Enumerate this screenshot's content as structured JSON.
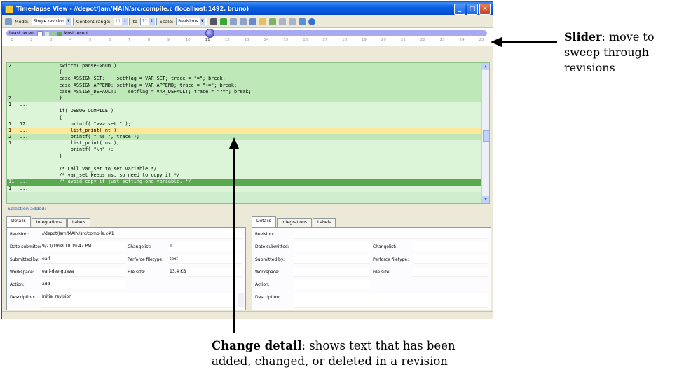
{
  "window": {
    "title": "Time-lapse View - //depot/Jam/MAIN/src/compile.c (localhost:1492, bruno)"
  },
  "toolbar": {
    "mode_label": "Mode:",
    "mode_value": "Single revision",
    "range_label": "Content range:",
    "range_from": "11",
    "range_to_label": "to",
    "range_to": "11",
    "scale_label": "Scale:",
    "scale_value": "Revisions"
  },
  "slider": {
    "least_recent": "Least recent",
    "most_recent": "Most recent",
    "ticks": [
      "1",
      "2",
      "3",
      "4",
      "5",
      "6",
      "7",
      "8",
      "9",
      "10",
      "11",
      "12",
      "13",
      "14",
      "15",
      "16",
      "17",
      "18",
      "19",
      "20",
      "21",
      "22",
      "23",
      "24",
      "25"
    ],
    "current_revision": "11"
  },
  "code_lines": [
    {
      "rev": "2",
      "chg": "...",
      "text": "    switch( parse->num )",
      "style": "mid"
    },
    {
      "rev": "",
      "chg": "",
      "text": "    {",
      "style": "mid"
    },
    {
      "rev": "",
      "chg": "",
      "text": "    case ASSIGN_SET:    setflag = VAR_SET; trace = \"=\"; break;",
      "style": "mid"
    },
    {
      "rev": "",
      "chg": "",
      "text": "    case ASSIGN_APPEND: setflag = VAR_APPEND; trace = \"+=\"; break;",
      "style": "mid"
    },
    {
      "rev": "",
      "chg": "",
      "text": "    case ASSIGN_DEFAULT:    setflag = VAR_DEFAULT; trace = \"?=\"; break;",
      "style": "mid"
    },
    {
      "rev": "2",
      "chg": "...",
      "text": "    }",
      "style": "mid"
    },
    {
      "rev": "1",
      "chg": "...",
      "text": "",
      "style": "light"
    },
    {
      "rev": "",
      "chg": "",
      "text": "    if( DEBUG_COMPILE )",
      "style": "light"
    },
    {
      "rev": "",
      "chg": "",
      "text": "    {",
      "style": "light"
    },
    {
      "rev": "1",
      "chg": "12",
      "text": "        printf( \">>> set \" );",
      "style": "light"
    },
    {
      "rev": "1",
      "chg": "...",
      "text": "        list_print( nt );",
      "style": "hl"
    },
    {
      "rev": "2",
      "chg": "...",
      "text": "        printf( \" %s \", trace );",
      "style": "mid"
    },
    {
      "rev": "1",
      "chg": "...",
      "text": "        list_print( ns );",
      "style": "light"
    },
    {
      "rev": "",
      "chg": "",
      "text": "        printf( \"\\n\" );",
      "style": "light"
    },
    {
      "rev": "",
      "chg": "",
      "text": "    }",
      "style": "light"
    },
    {
      "rev": "",
      "chg": "",
      "text": "",
      "style": "light"
    },
    {
      "rev": "",
      "chg": "",
      "text": "    /* Call var_set to set variable */",
      "style": "light"
    },
    {
      "rev": "",
      "chg": "",
      "text": "    /* var_set keeps ns, so need to copy it */",
      "style": "light"
    },
    {
      "rev": "11",
      "chg": "...",
      "text": "    /* avoid copy if just setting one variable. */",
      "style": "dark"
    },
    {
      "rev": "1",
      "chg": "...",
      "text": "",
      "style": "light"
    }
  ],
  "selection_label": "Selection added:",
  "tabs": [
    "Details",
    "Integrations",
    "Labels"
  ],
  "left_details": {
    "revision_label": "Revision:",
    "revision": "//depot/Jam/MAIN/src/compile.c#1",
    "date_label": "Date submitted:",
    "date": "9/23/1998 10:19:47 PM",
    "changelist_label": "Changelist:",
    "changelist": "1",
    "submitted_label": "Submitted by:",
    "submitted": "earl",
    "filetype_label": "Perforce filetype:",
    "filetype": "text",
    "workspace_label": "Workspace:",
    "workspace": "earl-dev-guava",
    "filesize_label": "File size:",
    "filesize": "13.4 KB",
    "action_label": "Action:",
    "action": "add",
    "description_label": "Description:",
    "description": "Initial revision"
  },
  "right_details": {
    "revision_label": "Revision:",
    "date_label": "Date submitted:",
    "changelist_label": "Changelist:",
    "submitted_label": "Submitted by:",
    "filetype_label": "Perforce filetype:",
    "workspace_label": "Workspace:",
    "filesize_label": "File size:",
    "action_label": "Action:",
    "description_label": "Description:"
  },
  "annotations": {
    "slider_title": "Slider",
    "slider_text_1": ": move to",
    "slider_text_2": "sweep through",
    "slider_text_3": "revisions",
    "change_title": "Change detail",
    "change_text_1": ": shows text that has been",
    "change_text_2": "added, changed, or deleted in a revision"
  },
  "colors": {
    "slider_track": "#a9a9f1",
    "added_dark": "#5aa84f",
    "highlight": "#fde89a",
    "code_bg": "#cfeecd"
  }
}
